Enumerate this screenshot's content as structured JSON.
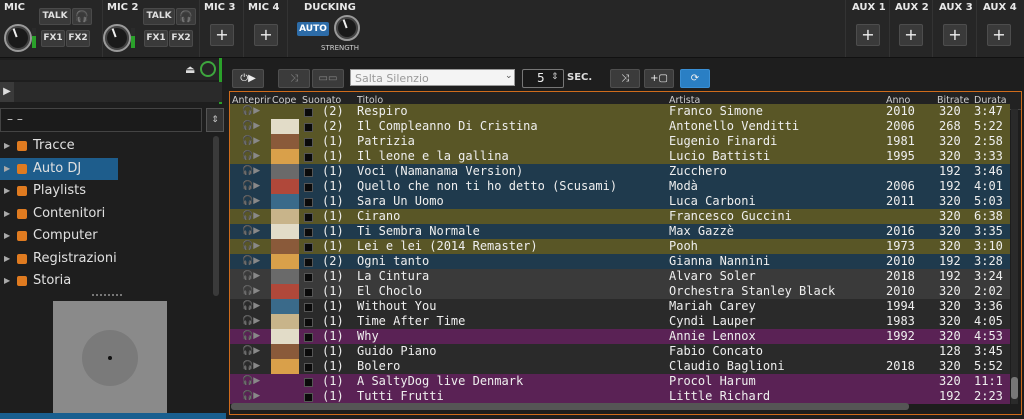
{
  "top": {
    "mic1": {
      "title": "MIC",
      "talk": "TALK",
      "fx1": "FX1",
      "fx2": "FX2"
    },
    "mic2": {
      "title": "MIC 2",
      "talk": "TALK",
      "fx1": "FX1",
      "fx2": "FX2"
    },
    "mic3": {
      "title": "MIC 3"
    },
    "mic4": {
      "title": "MIC 4"
    },
    "ducking": {
      "title": "DUCKING",
      "auto": "AUTO",
      "strength": "STRENGTH"
    },
    "aux": [
      {
        "title": "AUX 1"
      },
      {
        "title": "AUX 2"
      },
      {
        "title": "AUX 3"
      },
      {
        "title": "AUX 4"
      }
    ],
    "plus": "+"
  },
  "left": {
    "dash": "– –",
    "tree": [
      {
        "label": "Tracce",
        "icon": "music-note-icon",
        "color": "#e07b20"
      },
      {
        "label": "Auto DJ",
        "icon": "auto-dj-icon",
        "color": "#e07b20",
        "selected": true
      },
      {
        "label": "Playlists",
        "icon": "playlist-icon",
        "color": "#e07b20"
      },
      {
        "label": "Contenitori",
        "icon": "container-icon",
        "color": "#e07b20"
      },
      {
        "label": "Computer",
        "icon": "computer-icon",
        "color": "#e07b20"
      },
      {
        "label": "Registrazioni",
        "icon": "recording-icon",
        "color": "#e07b20"
      },
      {
        "label": "Storia",
        "icon": "history-icon",
        "color": "#e07b20"
      }
    ]
  },
  "toolbar": {
    "silence_option": "Salta Silenzio",
    "seconds_value": "5",
    "seconds_label": "SEC.",
    "add_label": "+"
  },
  "table": {
    "headers": {
      "preview": "Anteprir",
      "cover": "Cope",
      "played": "Suonato",
      "title": "Titolo",
      "artist": "Artista",
      "year": "Anno",
      "bitrate": "Bitrate",
      "duration": "Durata"
    },
    "rows": [
      {
        "played": "(2)",
        "title": "Respiro",
        "artist": "Franco Simone",
        "year": "2010",
        "bitrate": "320",
        "duration": "3:47",
        "color": "#595626"
      },
      {
        "played": "(2)",
        "title": "Il Compleanno Di Cristina",
        "artist": "Antonello Venditti",
        "year": "2006",
        "bitrate": "268",
        "duration": "5:22",
        "color": "#595626"
      },
      {
        "played": "(1)",
        "title": "Patrizia",
        "artist": "Eugenio Finardi",
        "year": "1981",
        "bitrate": "320",
        "duration": "2:58",
        "color": "#595626"
      },
      {
        "played": "(1)",
        "title": "Il leone e la gallina",
        "artist": "Lucio Battisti",
        "year": "1995",
        "bitrate": "320",
        "duration": "3:33",
        "color": "#595626"
      },
      {
        "played": "(1)",
        "title": "Voci (Namanama Version)",
        "artist": "Zucchero",
        "year": "",
        "bitrate": "192",
        "duration": "3:46",
        "color": "#1f3a4d"
      },
      {
        "played": "(1)",
        "title": "Quello che non ti ho detto (Scusami)",
        "artist": "Modà",
        "year": "2006",
        "bitrate": "192",
        "duration": "4:01",
        "color": "#1f3a4d"
      },
      {
        "played": "(1)",
        "title": "Sara Un Uomo",
        "artist": "Luca Carboni",
        "year": "2011",
        "bitrate": "320",
        "duration": "5:03",
        "color": "#1f3a4d"
      },
      {
        "played": "(1)",
        "title": "Cirano",
        "artist": "Francesco Guccini",
        "year": "",
        "bitrate": "320",
        "duration": "6:38",
        "color": "#595626"
      },
      {
        "played": "(1)",
        "title": "Ti Sembra Normale",
        "artist": "Max Gazzè",
        "year": "2016",
        "bitrate": "320",
        "duration": "3:35",
        "color": "#1f3a4d"
      },
      {
        "played": "(1)",
        "title": "Lei e lei (2014 Remaster)",
        "artist": "Pooh",
        "year": "1973",
        "bitrate": "320",
        "duration": "3:10",
        "color": "#595626"
      },
      {
        "played": "(2)",
        "title": "Ogni tanto",
        "artist": "Gianna Nannini",
        "year": "2010",
        "bitrate": "192",
        "duration": "3:28",
        "color": "#1f3a4d"
      },
      {
        "played": "(1)",
        "title": "La Cintura",
        "artist": "Alvaro Soler",
        "year": "2018",
        "bitrate": "192",
        "duration": "3:24",
        "color": "#3a3a3a"
      },
      {
        "played": "(1)",
        "title": "El Choclo",
        "artist": "Orchestra Stanley Black",
        "year": "2010",
        "bitrate": "320",
        "duration": "2:02",
        "color": "#3a3a3a"
      },
      {
        "played": "(1)",
        "title": "Without You",
        "artist": "Mariah Carey",
        "year": "1994",
        "bitrate": "320",
        "duration": "3:36",
        "color": "#2a2a2a"
      },
      {
        "played": "(1)",
        "title": "Time After Time",
        "artist": "Cyndi Lauper",
        "year": "1983",
        "bitrate": "320",
        "duration": "4:05",
        "color": "#2a2a2a"
      },
      {
        "played": "(1)",
        "title": "Why",
        "artist": "Annie Lennox",
        "year": "1992",
        "bitrate": "320",
        "duration": "4:53",
        "color": "#5a2255"
      },
      {
        "played": "(1)",
        "title": "Guido Piano",
        "artist": "Fabio Concato",
        "year": "",
        "bitrate": "128",
        "duration": "3:45",
        "color": "#2a2a2a"
      },
      {
        "played": "(1)",
        "title": "Bolero",
        "artist": "Claudio Baglioni",
        "year": "2018",
        "bitrate": "320",
        "duration": "5:52",
        "color": "#2a2a2a"
      },
      {
        "played": "(1)",
        "title": "A SaltyDog live Denmark",
        "artist": "Procol Harum",
        "year": "",
        "bitrate": "320",
        "duration": "11:1",
        "color": "#5a2255"
      },
      {
        "played": "(1)",
        "title": "Tutti Frutti",
        "artist": "Little Richard",
        "year": "",
        "bitrate": "192",
        "duration": "2:23",
        "color": "#5a2255"
      }
    ]
  }
}
